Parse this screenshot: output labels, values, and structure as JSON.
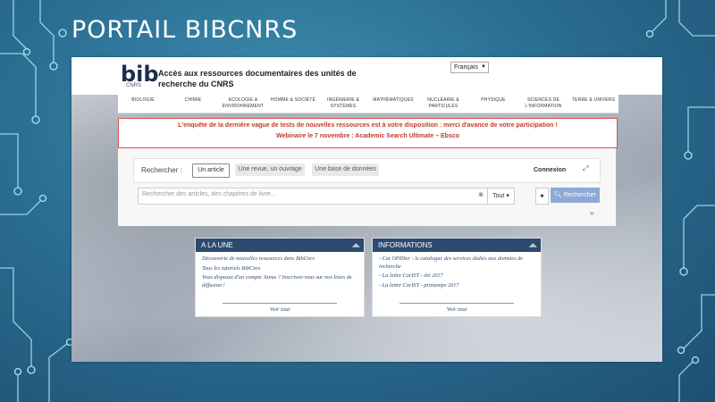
{
  "slide": {
    "title": "PORTAIL BIBCNRS"
  },
  "site": {
    "logo_main": "bib",
    "logo_sub": "CNRS",
    "title": "Accès aux ressources documentaires des unités de recherche du CNRS",
    "language": "Français"
  },
  "nav": {
    "items": [
      {
        "label": "BIOLOGIE"
      },
      {
        "label": "CHIMIE"
      },
      {
        "label": "ECOLOGIE & ENVIRONNEMENT"
      },
      {
        "label": "HOMME & SOCIÉTÉ"
      },
      {
        "label": "INGÉNIERIE & SYSTÈMES"
      },
      {
        "label": "MATHÉMATIQUES"
      },
      {
        "label": "NUCLÉAIRE & PARTICULES"
      },
      {
        "label": "PHYSIQUE"
      },
      {
        "label": "SCIENCES DE L'INFORMATION"
      },
      {
        "label": "TERRE & UNIVERS"
      }
    ]
  },
  "notice": {
    "line1": "L'enquête de la dernière vague de tests de nouvelles ressources est à votre disposition : merci d'avance de votre participation !",
    "line2": "Webinaire le 7 novembre : Academic Search Ultimate – Ebsco"
  },
  "search": {
    "label": "Rechercher :",
    "tabs": [
      {
        "label": "Un article"
      },
      {
        "label": "Une revue, un ouvrage"
      },
      {
        "label": "Une base de données"
      }
    ],
    "connexion": "Connexion",
    "placeholder": "Rechercher des articles, des chapitres de livre...",
    "scope": "Tout",
    "button": "Rechercher",
    "more": "»"
  },
  "a_la_une": {
    "title": "A LA UNE",
    "items": [
      "Découverte de nouvelles ressources dans BibCnrs",
      "Tous les tutoriels BibCnrs",
      "Vous disposez d'un compte Janus ? Inscrivez-vous sur nos listes de diffusion !"
    ],
    "voir_tout": "Voir tout"
  },
  "informations": {
    "title": "INFORMATIONS",
    "items": [
      "- Cat OPIDor : le catalogue des services dédiés aux données de recherche",
      "- La lettre CorIST - été 2017",
      "- La lettre CorIST - printemps 2017"
    ],
    "voir_tout": "Voir tout"
  },
  "colors": {
    "slide_bg": "#2b6f93",
    "circuit": "#a9e6f5",
    "card_header": "#2c4a6e",
    "notice_red": "#c0392b",
    "search_button": "#8ea9d4"
  }
}
